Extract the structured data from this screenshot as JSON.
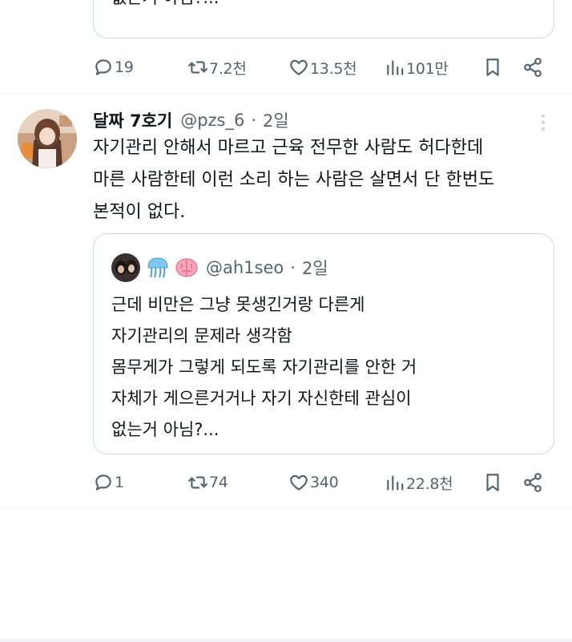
{
  "tweet1": {
    "quote_last_line": "없는거 아님?...",
    "actions": {
      "replies": "19",
      "retweets": "7.2천",
      "likes": "13.5천",
      "views": "101만"
    }
  },
  "tweet2": {
    "author_name": "달짜 7호기",
    "handle": "@pzs_6",
    "separator": "·",
    "time": "2일",
    "body_lines": [
      "자기관리 안해서 마르고 근육 전무한 사람도 허다한데",
      "마른 사람한테 이런 소리 하는 사람은 살면서 단 한번도",
      "본적이 없다."
    ],
    "quote": {
      "handle": "@ah1seo",
      "separator": "·",
      "time": "2일",
      "emoji_icons": [
        "jellyfish-icon",
        "brain-icon"
      ],
      "lines": [
        "근데 비만은 그냥 못생긴거랑 다른게",
        "자기관리의 문제라 생각함",
        "몸무게가 그렇게 되도록 자기관리를 안한 거",
        "자체가 게으른거거나 자기 자신한테 관심이",
        "없는거 아님?..."
      ]
    },
    "actions": {
      "replies": "1",
      "retweets": "74",
      "likes": "340",
      "views": "22.8천"
    }
  },
  "colors": {
    "text": "#0f1419",
    "secondary": "#536471",
    "border": "#cfd9de",
    "divider": "#eff3f4"
  }
}
